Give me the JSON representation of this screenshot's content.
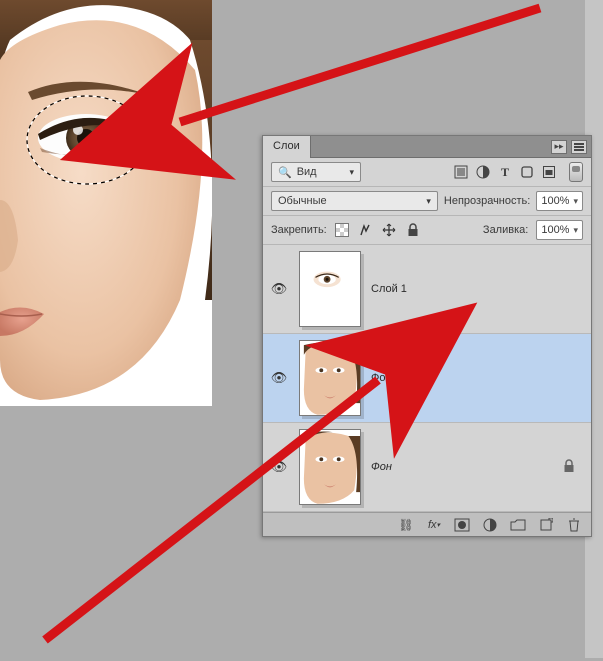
{
  "panel": {
    "title": "Слои",
    "search_label": "Вид",
    "blend_mode": "Обычные",
    "opacity_label": "Непрозрачность:",
    "opacity_value": "100%",
    "lock_label": "Закрепить:",
    "fill_label": "Заливка:",
    "fill_value": "100%"
  },
  "filter_icons": {
    "pixel": "pixel-filter-icon",
    "adjust": "adjustment-filter-icon",
    "type": "T",
    "shape": "shape-filter-icon",
    "smart": "smart-filter-icon"
  },
  "layers": [
    {
      "name": "Слой 1",
      "visible": true,
      "selected": false,
      "locked": false,
      "thumb": "eye-cutout",
      "italic": false
    },
    {
      "name": "Фон копия",
      "visible": true,
      "selected": true,
      "locked": false,
      "thumb": "face",
      "italic": false
    },
    {
      "name": "Фон",
      "visible": true,
      "selected": false,
      "locked": true,
      "thumb": "face",
      "italic": true
    }
  ],
  "footer_icons": [
    "link-icon",
    "fx-icon",
    "mask-icon",
    "adjustment-icon",
    "group-icon",
    "new-layer-icon",
    "trash-icon"
  ]
}
